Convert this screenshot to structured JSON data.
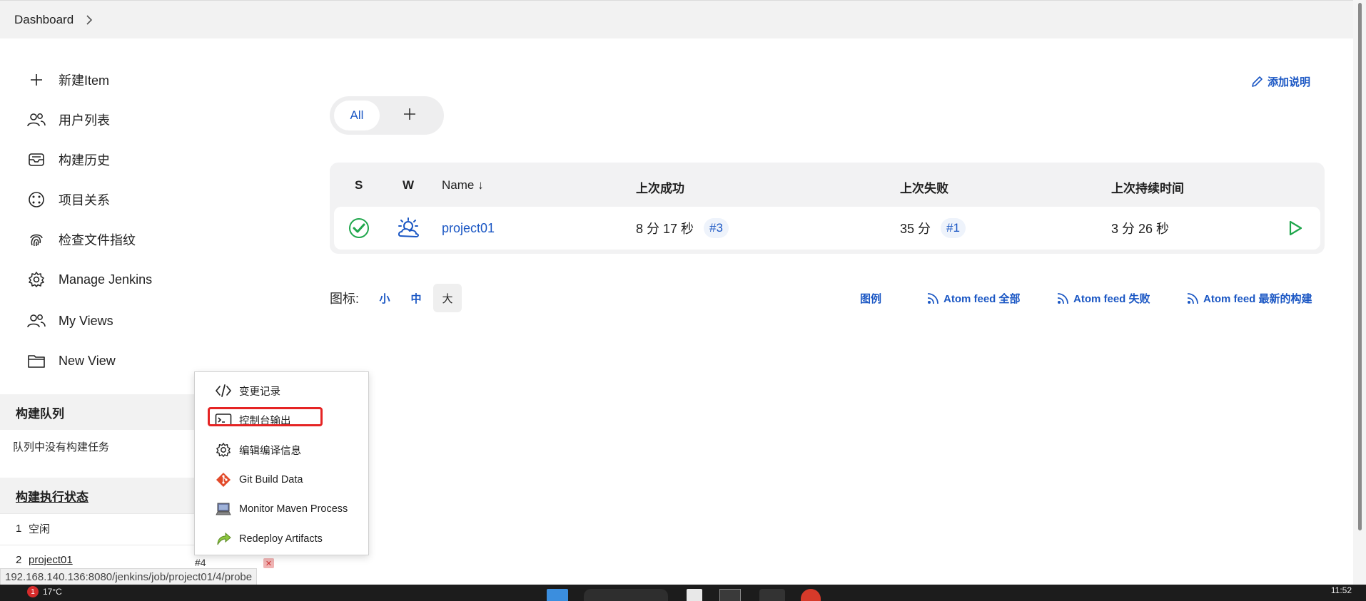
{
  "breadcrumb": {
    "items": [
      "Dashboard"
    ]
  },
  "sidebar": {
    "tasks": [
      {
        "label": "新建Item",
        "icon": "plus-icon"
      },
      {
        "label": "用户列表",
        "icon": "users-icon"
      },
      {
        "label": "构建历史",
        "icon": "inbox-icon"
      },
      {
        "label": "项目关系",
        "icon": "relation-icon"
      },
      {
        "label": "检查文件指纹",
        "icon": "fingerprint-icon"
      },
      {
        "label": "Manage Jenkins",
        "icon": "gear-icon"
      },
      {
        "label": "My Views",
        "icon": "users-icon"
      },
      {
        "label": "New View",
        "icon": "folder-icon"
      }
    ],
    "build_queue": {
      "title": "构建队列",
      "empty_text": "队列中没有构建任务"
    },
    "executors": {
      "title": "构建执行状态",
      "rows": [
        {
          "num": "1",
          "text": "空闲"
        },
        {
          "num": "2",
          "text": "project01",
          "build": "#4"
        }
      ]
    }
  },
  "main": {
    "add_description": "添加说明",
    "tabs": {
      "all": "All"
    },
    "table": {
      "headers": {
        "s": "S",
        "w": "W",
        "name": "Name ↓",
        "last_success": "上次成功",
        "last_failure": "上次失败",
        "last_duration": "上次持续时间"
      },
      "rows": [
        {
          "name": "project01",
          "last_success": "8 分 17 秒",
          "last_success_build": "#3",
          "last_failure": "35 分",
          "last_failure_build": "#1",
          "last_duration": "3 分 26 秒"
        }
      ]
    },
    "icon_size": {
      "label": "图标:",
      "small": "小",
      "medium": "中",
      "large": "大"
    },
    "links": {
      "legend": "图例",
      "feed_all": "Atom feed 全部",
      "feed_failed": "Atom feed 失败",
      "feed_latest": "Atom feed 最新的构建"
    }
  },
  "context_menu": {
    "items": [
      {
        "label": "变更记录",
        "icon": "code-icon"
      },
      {
        "label": "控制台输出",
        "icon": "terminal-icon"
      },
      {
        "label": "编辑编译信息",
        "icon": "gear-icon"
      },
      {
        "label": "Git Build Data",
        "icon": "git-icon"
      },
      {
        "label": "Monitor Maven Process",
        "icon": "computer-icon"
      },
      {
        "label": "Redeploy Artifacts",
        "icon": "redeploy-icon"
      }
    ]
  },
  "status_bar": {
    "url": "192.168.140.136:8080/jenkins/job/project01/4/probe"
  },
  "taskbar": {
    "weather": "17°C",
    "notification_count": "1",
    "clock": "11:52"
  },
  "colors": {
    "accent": "#1b57c4",
    "success": "#1ea64b",
    "highlight": "#e52424"
  }
}
